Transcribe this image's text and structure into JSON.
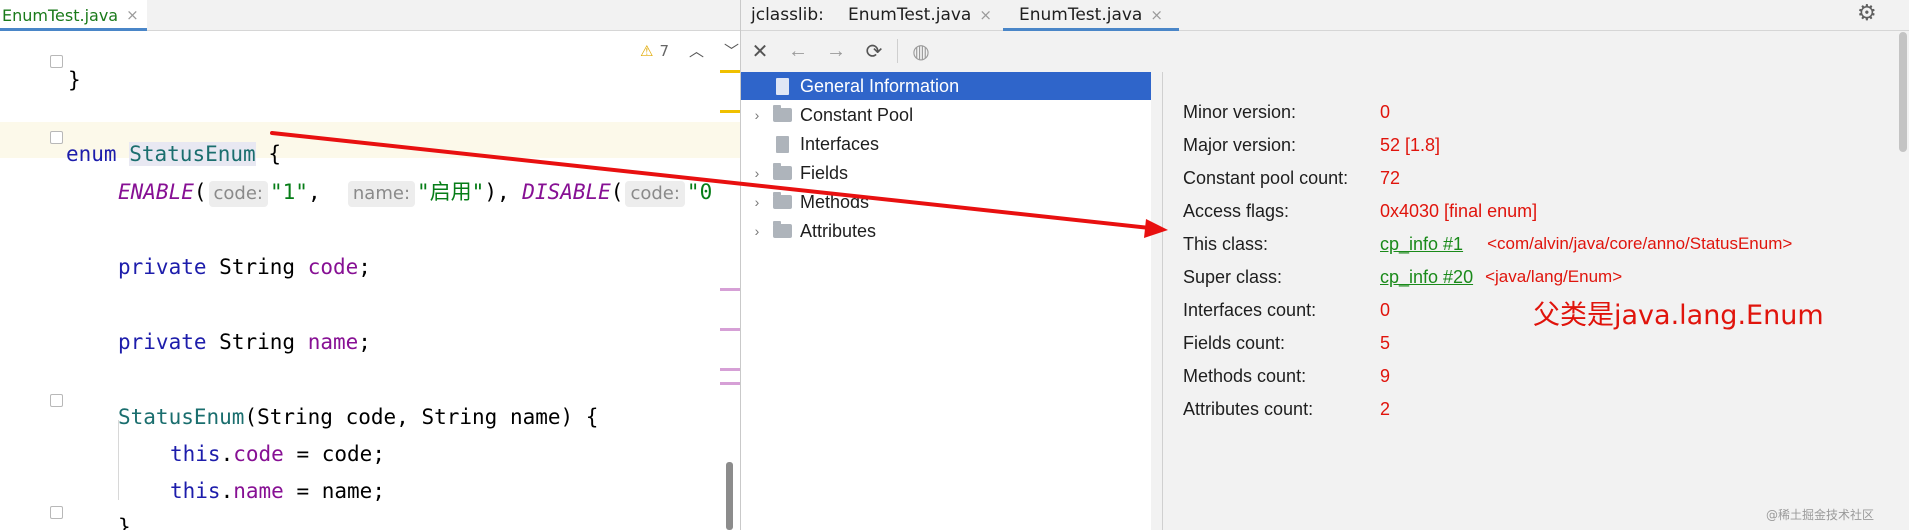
{
  "editor": {
    "tab": {
      "label": "EnumTest.java",
      "close": "×"
    },
    "warnings": {
      "count": "7"
    },
    "code": {
      "brace_close": "}",
      "kw_enum": "enum",
      "enum_name": "StatusEnum",
      "brace_open": "{",
      "c_enable": "ENABLE",
      "paren_open": "(",
      "hint_code": "code:",
      "v1": "\"1\"",
      "comma": ",",
      "hint_name": "name:",
      "v2": "\"启用\"",
      "close_comma": "),",
      "c_disable": "DISABLE",
      "hint_code2": "code:",
      "v3": "\"0",
      "kw_private": "private",
      "type_string": "String",
      "f_code": "code",
      "f_name": "name",
      "semi": ";",
      "ctor_params": "(String code, String name) {",
      "kw_this": "this",
      "dot": ".",
      "assign_code": " = code;",
      "assign_name": " = name;"
    }
  },
  "jclasslib": {
    "tabs": [
      "jclasslib:",
      "EnumTest.java",
      "EnumTest.java"
    ],
    "tab_close": "×",
    "tree": [
      {
        "label": "General Information",
        "selected": true,
        "icon": "file-icon",
        "expandable": false
      },
      {
        "label": "Constant Pool",
        "selected": false,
        "icon": "folder-icon",
        "expandable": true
      },
      {
        "label": "Interfaces",
        "selected": false,
        "icon": "file-icon",
        "expandable": false
      },
      {
        "label": "Fields",
        "selected": false,
        "icon": "folder-icon",
        "expandable": true
      },
      {
        "label": "Methods",
        "selected": false,
        "icon": "folder-icon",
        "expandable": true
      },
      {
        "label": "Attributes",
        "selected": false,
        "icon": "folder-icon",
        "expandable": true
      }
    ],
    "info": [
      {
        "label": "Minor version:",
        "value": "0"
      },
      {
        "label": "Major version:",
        "value": "52 [1.8]"
      },
      {
        "label": "Constant pool count:",
        "value": "72"
      },
      {
        "label": "Access flags:",
        "value": "0x4030 [final enum]"
      },
      {
        "label": "This class:",
        "value": "cp_info #1",
        "extra": "<com/alvin/java/core/anno/StatusEnum>"
      },
      {
        "label": "Super class:",
        "value": "cp_info #20",
        "extra": "<java/lang/Enum>"
      },
      {
        "label": "Interfaces count:",
        "value": "0"
      },
      {
        "label": "Fields count:",
        "value": "5"
      },
      {
        "label": "Methods count:",
        "value": "9"
      },
      {
        "label": "Attributes count:",
        "value": "2"
      }
    ],
    "annotation": "父类是java.lang.Enum",
    "watermark": "@稀土掘金技术社区"
  },
  "colors": {
    "accent": "#2f65ca",
    "annotation_red": "#e0140c",
    "link_green": "#1a8a1a"
  }
}
